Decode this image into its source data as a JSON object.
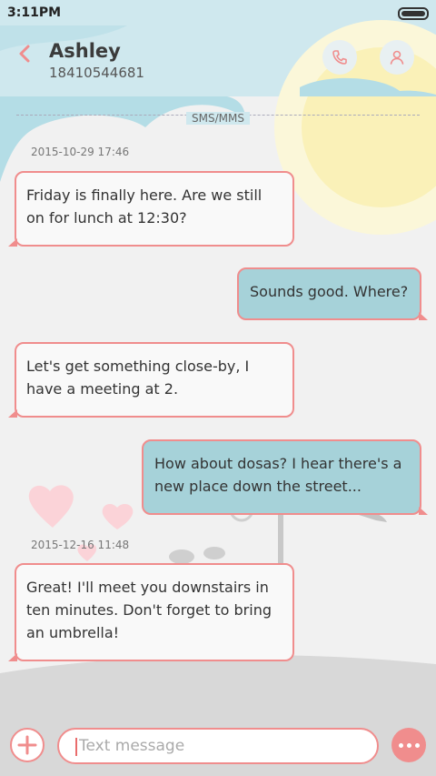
{
  "status_bar": {
    "time": "3:11PM"
  },
  "header": {
    "contact_name": "Ashley",
    "contact_number": "18410544681"
  },
  "divider": {
    "label": "SMS/MMS"
  },
  "timestamps": [
    "2015-10-29 17:46",
    "2015-12-16 11:48"
  ],
  "messages": [
    {
      "direction": "incoming",
      "text": "Friday is finally here. Are we still on for lunch at 12:30?"
    },
    {
      "direction": "outgoing",
      "text": "Sounds good. Where?"
    },
    {
      "direction": "incoming",
      "text": "Let's get something close-by, I have a meeting at 2."
    },
    {
      "direction": "outgoing",
      "text": "How about dosas? I hear there's a new place down the street..."
    },
    {
      "direction": "incoming",
      "text": "Great! I'll meet you downstairs in ten minutes. Don't forget to bring an umbrella!"
    }
  ],
  "composer": {
    "placeholder": "Text message",
    "value": ""
  },
  "colors": {
    "accent": "#f08d8d",
    "incoming_bubble": "#f9f9f9",
    "outgoing_bubble": "#a6d2d9",
    "sky": "#cfe8ee",
    "sun": "#faf4c8",
    "background": "#f1f1f1"
  },
  "icons": {
    "back": "chevron-left-icon",
    "call": "phone-icon",
    "profile": "person-icon",
    "add": "plus-icon",
    "more": "more-dots-icon"
  }
}
